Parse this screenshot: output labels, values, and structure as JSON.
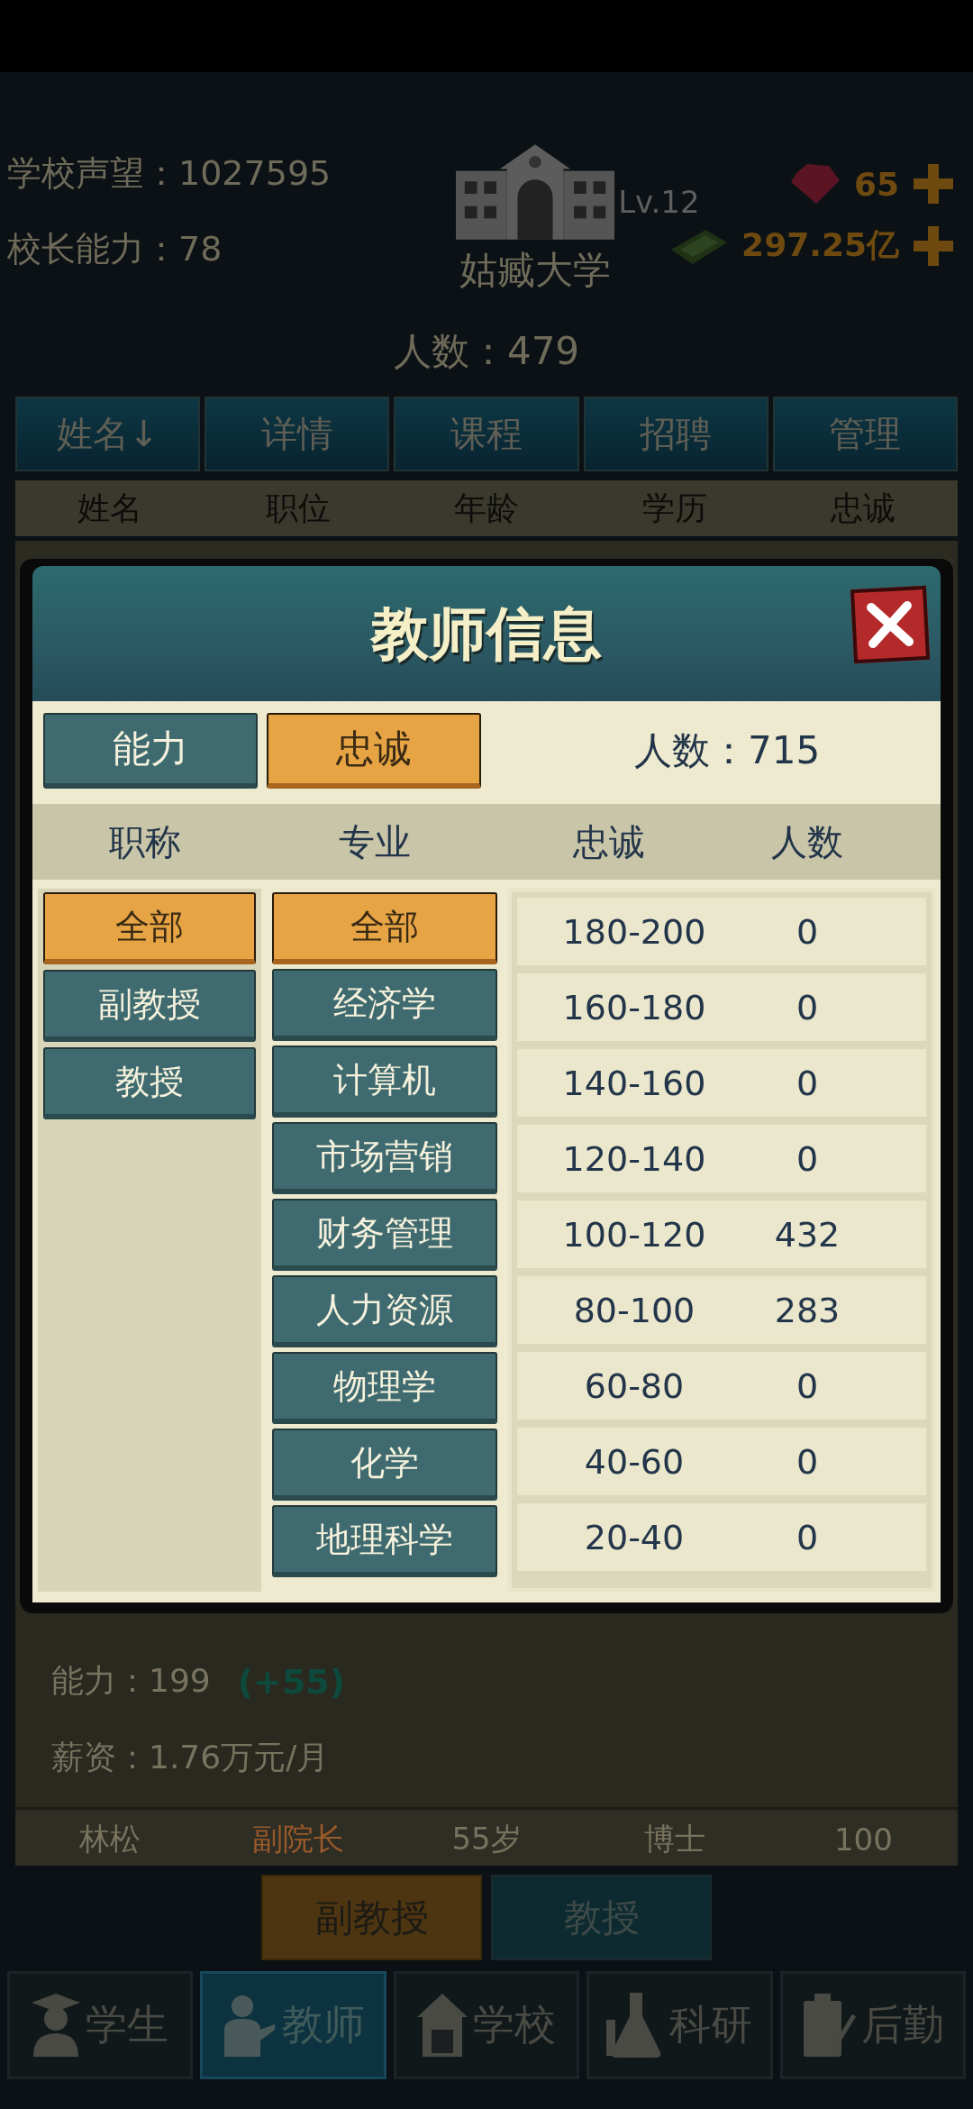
{
  "header": {
    "reputation": "学校声望：1027595",
    "ability": "校长能力：78",
    "school_name": "姑臧大学",
    "level": "Lv.12",
    "population": "人数：479",
    "gems": "65",
    "money": "297.25亿"
  },
  "tabs": [
    {
      "label": "姓名↓"
    },
    {
      "label": "详情"
    },
    {
      "label": "课程"
    },
    {
      "label": "招聘"
    },
    {
      "label": "管理"
    }
  ],
  "table": {
    "columns": [
      "姓名",
      "职位",
      "年龄",
      "学历",
      "忠诚"
    ],
    "detail": {
      "ability": "能力：199",
      "bonus": "(+55)",
      "salary": "薪资：1.76万元/月"
    },
    "rows": [
      {
        "name": "林松",
        "position": "副院长",
        "age": "55岁",
        "degree": "博士",
        "loyalty": "100"
      }
    ]
  },
  "rank_tabs": [
    {
      "label": "副教授",
      "selected": true
    },
    {
      "label": "教授",
      "selected": false
    }
  ],
  "nav": [
    {
      "label": "学生",
      "selected": false
    },
    {
      "label": "教师",
      "selected": true
    },
    {
      "label": "学校",
      "selected": false
    },
    {
      "label": "科研",
      "selected": false
    },
    {
      "label": "后勤",
      "selected": false
    }
  ],
  "dialog": {
    "title": "教师信息",
    "modes": [
      {
        "label": "能力",
        "selected": false
      },
      {
        "label": "忠诚",
        "selected": true
      }
    ],
    "count": "人数：715",
    "columns": [
      "职称",
      "专业",
      "忠诚",
      "人数"
    ],
    "titles": [
      {
        "label": "全部",
        "selected": true
      },
      {
        "label": "副教授",
        "selected": false
      },
      {
        "label": "教授",
        "selected": false
      }
    ],
    "majors": [
      {
        "label": "全部",
        "selected": true
      },
      {
        "label": "经济学",
        "selected": false
      },
      {
        "label": "计算机",
        "selected": false
      },
      {
        "label": "市场营销",
        "selected": false
      },
      {
        "label": "财务管理",
        "selected": false
      },
      {
        "label": "人力资源",
        "selected": false
      },
      {
        "label": "物理学",
        "selected": false
      },
      {
        "label": "化学",
        "selected": false
      },
      {
        "label": "地理科学",
        "selected": false
      }
    ],
    "ranges": [
      {
        "range": "180-200",
        "count": "0"
      },
      {
        "range": "160-180",
        "count": "0"
      },
      {
        "range": "140-160",
        "count": "0"
      },
      {
        "range": "120-140",
        "count": "0"
      },
      {
        "range": "100-120",
        "count": "432"
      },
      {
        "range": "80-100",
        "count": "283"
      },
      {
        "range": "60-80",
        "count": "0"
      },
      {
        "range": "40-60",
        "count": "0"
      },
      {
        "range": "20-40",
        "count": "0"
      }
    ]
  }
}
